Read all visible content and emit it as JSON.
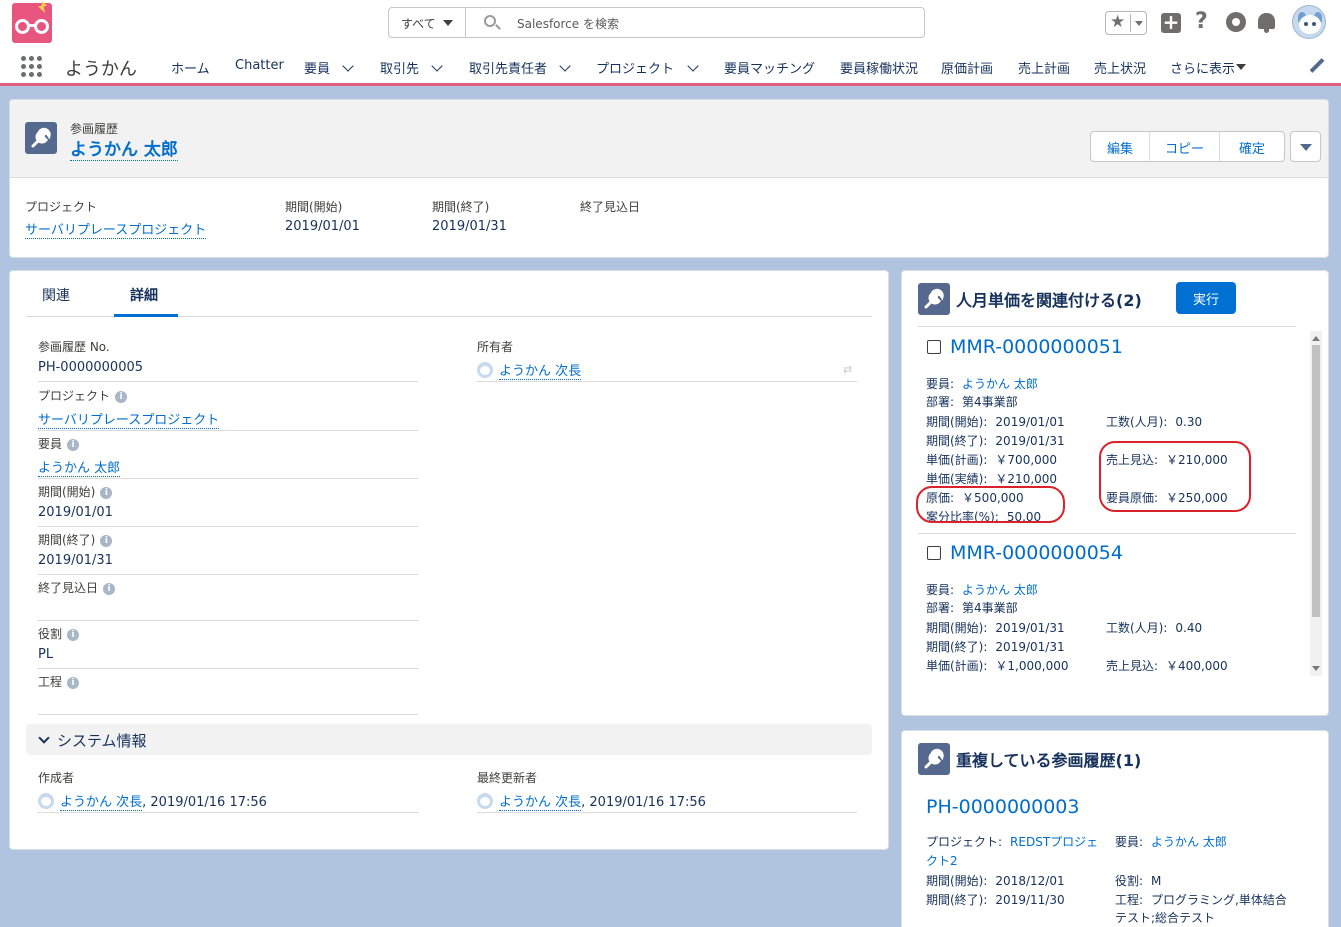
{
  "header": {
    "search_scope": "すべて",
    "search_placeholder": "Salesforce を検索",
    "icons": [
      "app-logo-icon",
      "search-icon",
      "favorites-star-icon",
      "global-create-icon",
      "help-icon",
      "setup-gear-icon",
      "notification-bell-icon",
      "user-avatar-icon"
    ]
  },
  "nav": {
    "app_name": "ようかん",
    "items": [
      "ホーム",
      "Chatter",
      "要員",
      "取引先",
      "取引先責任者",
      "プロジェクト",
      "要員マッチング",
      "要員稼働状況",
      "原価計画",
      "売上計画",
      "売上状況",
      "さらに表示"
    ]
  },
  "record": {
    "object_type": "参画履歴",
    "name": "ようかん 太郎",
    "actions": [
      "編集",
      "コピー",
      "確定"
    ],
    "highlights": [
      {
        "label": "プロジェクト",
        "value": "サーバリプレースプロジェクト"
      },
      {
        "label": "期間(開始)",
        "value": "2019/01/01"
      },
      {
        "label": "期間(終了)",
        "value": "2019/01/31"
      },
      {
        "label": "終了見込日",
        "value": ""
      }
    ]
  },
  "detail": {
    "tabs": [
      "関連",
      "詳細"
    ],
    "fields": {
      "no": {
        "label": "参画履歴 No.",
        "value": "PH-0000000005"
      },
      "project": {
        "label": "プロジェクト",
        "value": "サーバリプレースプロジェクト"
      },
      "member": {
        "label": "要員",
        "value": "ようかん 太郎"
      },
      "start": {
        "label": "期間(開始)",
        "value": "2019/01/01"
      },
      "end": {
        "label": "期間(終了)",
        "value": "2019/01/31"
      },
      "expected_end": {
        "label": "終了見込日",
        "value": ""
      },
      "role": {
        "label": "役割",
        "value": "PL"
      },
      "process": {
        "label": "工程",
        "value": ""
      },
      "owner": {
        "label": "所有者",
        "value": "ようかん 次長"
      }
    },
    "system_section": "システム情報",
    "created_by": {
      "label": "作成者",
      "user": "ようかん 次長",
      "date": ", 2019/01/16 17:56"
    },
    "modified_by": {
      "label": "最終更新者",
      "user": "ようかん 次長",
      "date": ", 2019/01/16 17:56"
    }
  },
  "related_rates": {
    "title": "人月単価を関連付ける(2)",
    "run_label": "実行",
    "records": [
      {
        "no": "MMR-0000000051",
        "member_k": "要員:",
        "member_v": "ようかん 太郎",
        "dept_k": "部署:",
        "dept_v": "第4事業部",
        "start_k": "期間(開始):",
        "start_v": "2019/01/01",
        "effort_k": "工数(人月):",
        "effort_v": "0.30",
        "end_k": "期間(終了):",
        "end_v": "2019/01/31",
        "plan_k": "単価(計画):",
        "plan_v": "￥700,000",
        "sales_k": "売上見込:",
        "sales_v": "￥210,000",
        "actual_k": "単価(実績):",
        "actual_v": "￥210,000",
        "cost_k": "原価:",
        "cost_v": "￥500,000",
        "mcost_k": "要員原価:",
        "mcost_v": "￥250,000",
        "ratio_k": "案分比率(%):",
        "ratio_v": "50.00"
      },
      {
        "no": "MMR-0000000054",
        "member_k": "要員:",
        "member_v": "ようかん 太郎",
        "dept_k": "部署:",
        "dept_v": "第4事業部",
        "start_k": "期間(開始):",
        "start_v": "2019/01/31",
        "effort_k": "工数(人月):",
        "effort_v": "0.40",
        "end_k": "期間(終了):",
        "end_v": "2019/01/31",
        "plan_k": "単価(計画):",
        "plan_v": "￥1,000,000",
        "sales_k": "売上見込:",
        "sales_v": "￥400,000"
      }
    ]
  },
  "duplicates": {
    "title": "重複している参画履歴(1)",
    "record_no": "PH-0000000003",
    "project_k": "プロジェクト:",
    "project_v1": "REDSTプロジェ",
    "project_v2": "クト2",
    "member_k": "要員:",
    "member_v": "ようかん 太郎",
    "start_k": "期間(開始):",
    "start_v": "2018/12/01",
    "role_k": "役割:",
    "role_v": "M",
    "end_k": "期間(終了):",
    "end_v": "2019/11/30",
    "process_k": "工程:",
    "process_v1": "プログラミング,単体結合",
    "process_v2": "テスト;総合テスト"
  },
  "colors": {
    "brand_pink": "#e05e80",
    "link": "#006dcc",
    "button": "#0070d2",
    "annotation_red": "#d9222a"
  }
}
